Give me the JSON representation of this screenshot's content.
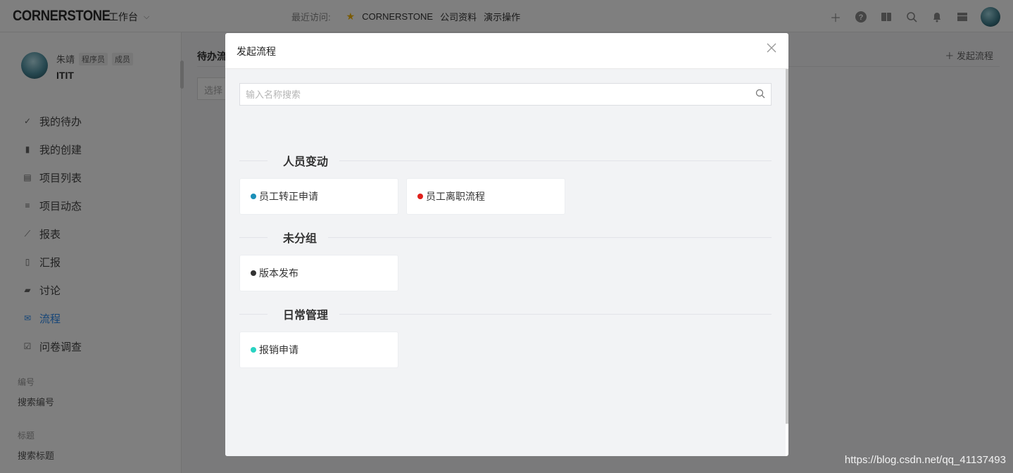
{
  "header": {
    "logo": "CORNERSTONE",
    "workspace": "工作台",
    "recent_label": "最近访问:",
    "recent_items": [
      "CORNERSTONE",
      "公司资料",
      "演示操作"
    ]
  },
  "sidebar": {
    "user_name": "朱靖",
    "tags": [
      "程序员",
      "成员"
    ],
    "org": "ITIT",
    "items": [
      {
        "label": "我的待办",
        "icon": "check-icon"
      },
      {
        "label": "我的创建",
        "icon": "file-icon"
      },
      {
        "label": "项目列表",
        "icon": "list-icon"
      },
      {
        "label": "项目动态",
        "icon": "lines-icon"
      },
      {
        "label": "报表",
        "icon": "trend-icon"
      },
      {
        "label": "汇报",
        "icon": "clipboard-icon"
      },
      {
        "label": "讨论",
        "icon": "chat-icon"
      },
      {
        "label": "流程",
        "icon": "mail-icon",
        "active": true
      },
      {
        "label": "问卷调查",
        "icon": "checkbox-icon"
      }
    ],
    "sections": [
      {
        "label": "编号",
        "link": "搜索编号"
      },
      {
        "label": "标题",
        "link": "搜索标题"
      }
    ]
  },
  "main": {
    "title": "待办流",
    "select_placeholder": "选择",
    "start_button": "发起流程"
  },
  "modal": {
    "title": "发起流程",
    "search_placeholder": "输入名称搜索",
    "groups": [
      {
        "name": "人员变动",
        "items": [
          {
            "label": "员工转正申请",
            "color": "#1b8fb8"
          },
          {
            "label": "员工离职流程",
            "color": "#e0201b"
          }
        ]
      },
      {
        "name": "未分组",
        "items": [
          {
            "label": "版本发布",
            "color": "#333333"
          }
        ]
      },
      {
        "name": "日常管理",
        "items": [
          {
            "label": "报销申请",
            "color": "#29d3c2"
          }
        ]
      }
    ]
  },
  "watermark": "https://blog.csdn.net/qq_41137493"
}
